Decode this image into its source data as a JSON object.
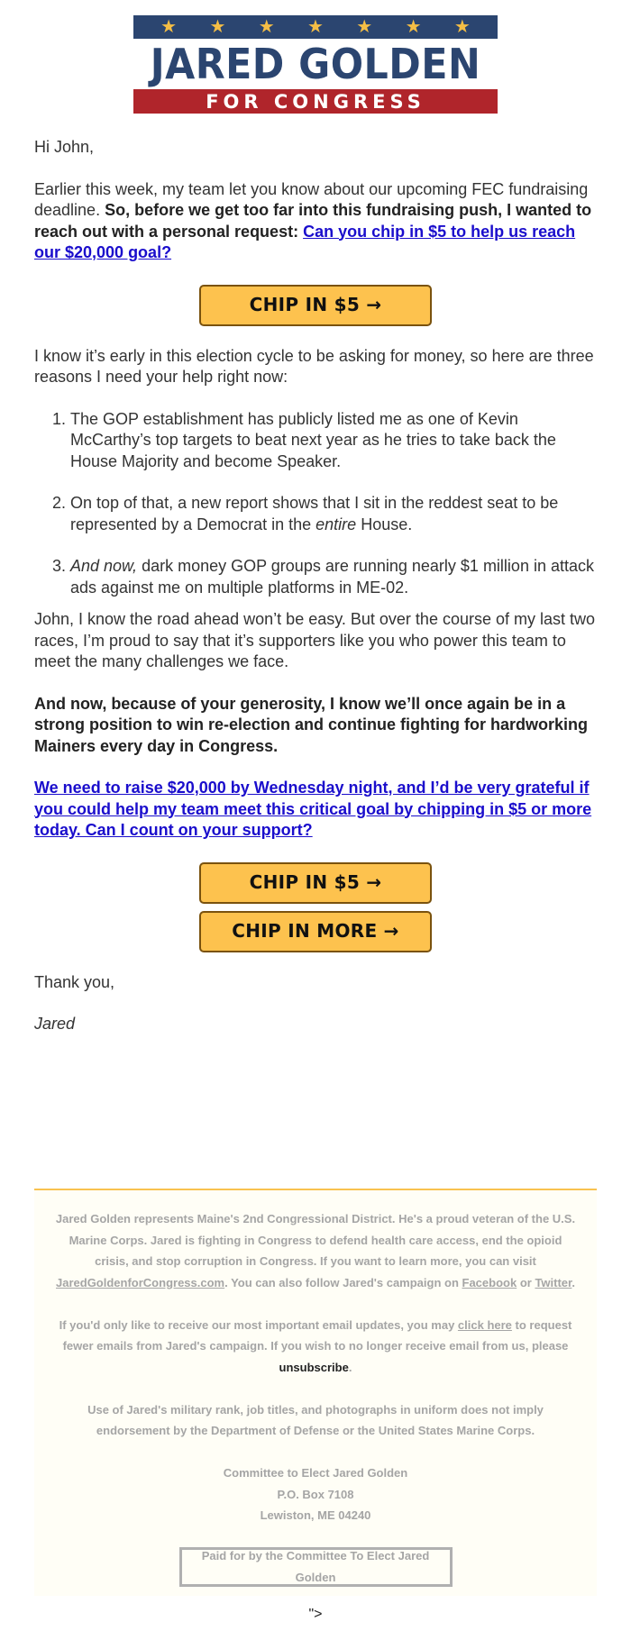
{
  "logo": {
    "star_count": 7,
    "star_glyph": "★",
    "name": "JARED GOLDEN",
    "subtitle": "FOR CONGRESS",
    "colors": {
      "navy": "#2b4570",
      "gold": "#f5be45",
      "red": "#b0252b"
    }
  },
  "email": {
    "greeting": "Hi John,",
    "intro": {
      "plain": "Earlier this week, my team let you know about our upcoming FEC fundraising deadline. ",
      "bold": "So, before we get too far into this fundraising push, I wanted to reach out with a personal request: ",
      "link": "Can you chip in $5 to help us reach our $20,000 goal?"
    },
    "buttons": {
      "chip5_top": "CHIP IN $5 →",
      "chip5_bottom": "CHIP IN $5 →",
      "chip_more": "CHIP IN MORE →"
    },
    "reasons_intro": "I know it’s early in this election cycle to be asking for money, so here are three reasons I need your help right now:",
    "reasons": [
      {
        "text": "The GOP establishment has publicly listed me as one of Kevin McCarthy’s top targets to beat next year as he tries to take back the House Majority and become Speaker."
      },
      {
        "before": "On top of that, a new report shows that I sit in the reddest seat to be represented by a Democrat in the ",
        "italic": "entire",
        "after": " House."
      },
      {
        "italic": "And now,",
        "after": " dark money GOP groups are running nearly $1 million in attack ads against me on multiple platforms in ME-02."
      }
    ],
    "road_ahead": "John, I know the road ahead won’t be easy. But over the course of my last two races, I’m proud to say that it’s supporters like you who power this team to meet the many challenges we face.",
    "generosity": "And now, because of your generosity, I know we’ll once again be in a strong position to win re-election and continue fighting for hardworking Mainers every day in Congress.",
    "goal_link": "We need to raise $20,000 by Wednesday night, and I’d be very grateful if you could help my team meet this critical goal by chipping in $5 or more today. Can I count on your support?",
    "signoff": "Thank you,",
    "signature": "Jared"
  },
  "footer": {
    "bio": {
      "text1": "Jared Golden represents Maine's 2nd Congressional District. He's a proud veteran of the U.S. Marine Corps. Jared is fighting in Congress to defend health care access, end the opioid crisis, and stop corruption in Congress. If you want to learn more, you can visit ",
      "site_link": "JaredGoldenforCongress.com",
      "text2": ". You can also follow Jared's campaign on ",
      "facebook_link": "Facebook",
      "text3": " or ",
      "twitter_link": "Twitter",
      "text4": "."
    },
    "prefs": {
      "text1": "If you'd only like to receive our most important email updates, you may ",
      "click_here_link": "click here",
      "text2": " to request fewer emails from Jared's campaign. If you wish to no longer receive email from us, please ",
      "unsubscribe_link": "unsubscribe",
      "text3": "."
    },
    "disclaimer": "Use of Jared's military rank, job titles, and photographs in uniform does not imply endorsement by the Department of Defense or the United States Marine Corps.",
    "address": {
      "line1": "Committee to Elect Jared Golden",
      "line2": "P.O. Box 7108",
      "line3": "Lewiston, ME 04240"
    },
    "paid_for": "Paid for by the Committee To Elect Jared Golden"
  },
  "stray_markup": "\">"
}
